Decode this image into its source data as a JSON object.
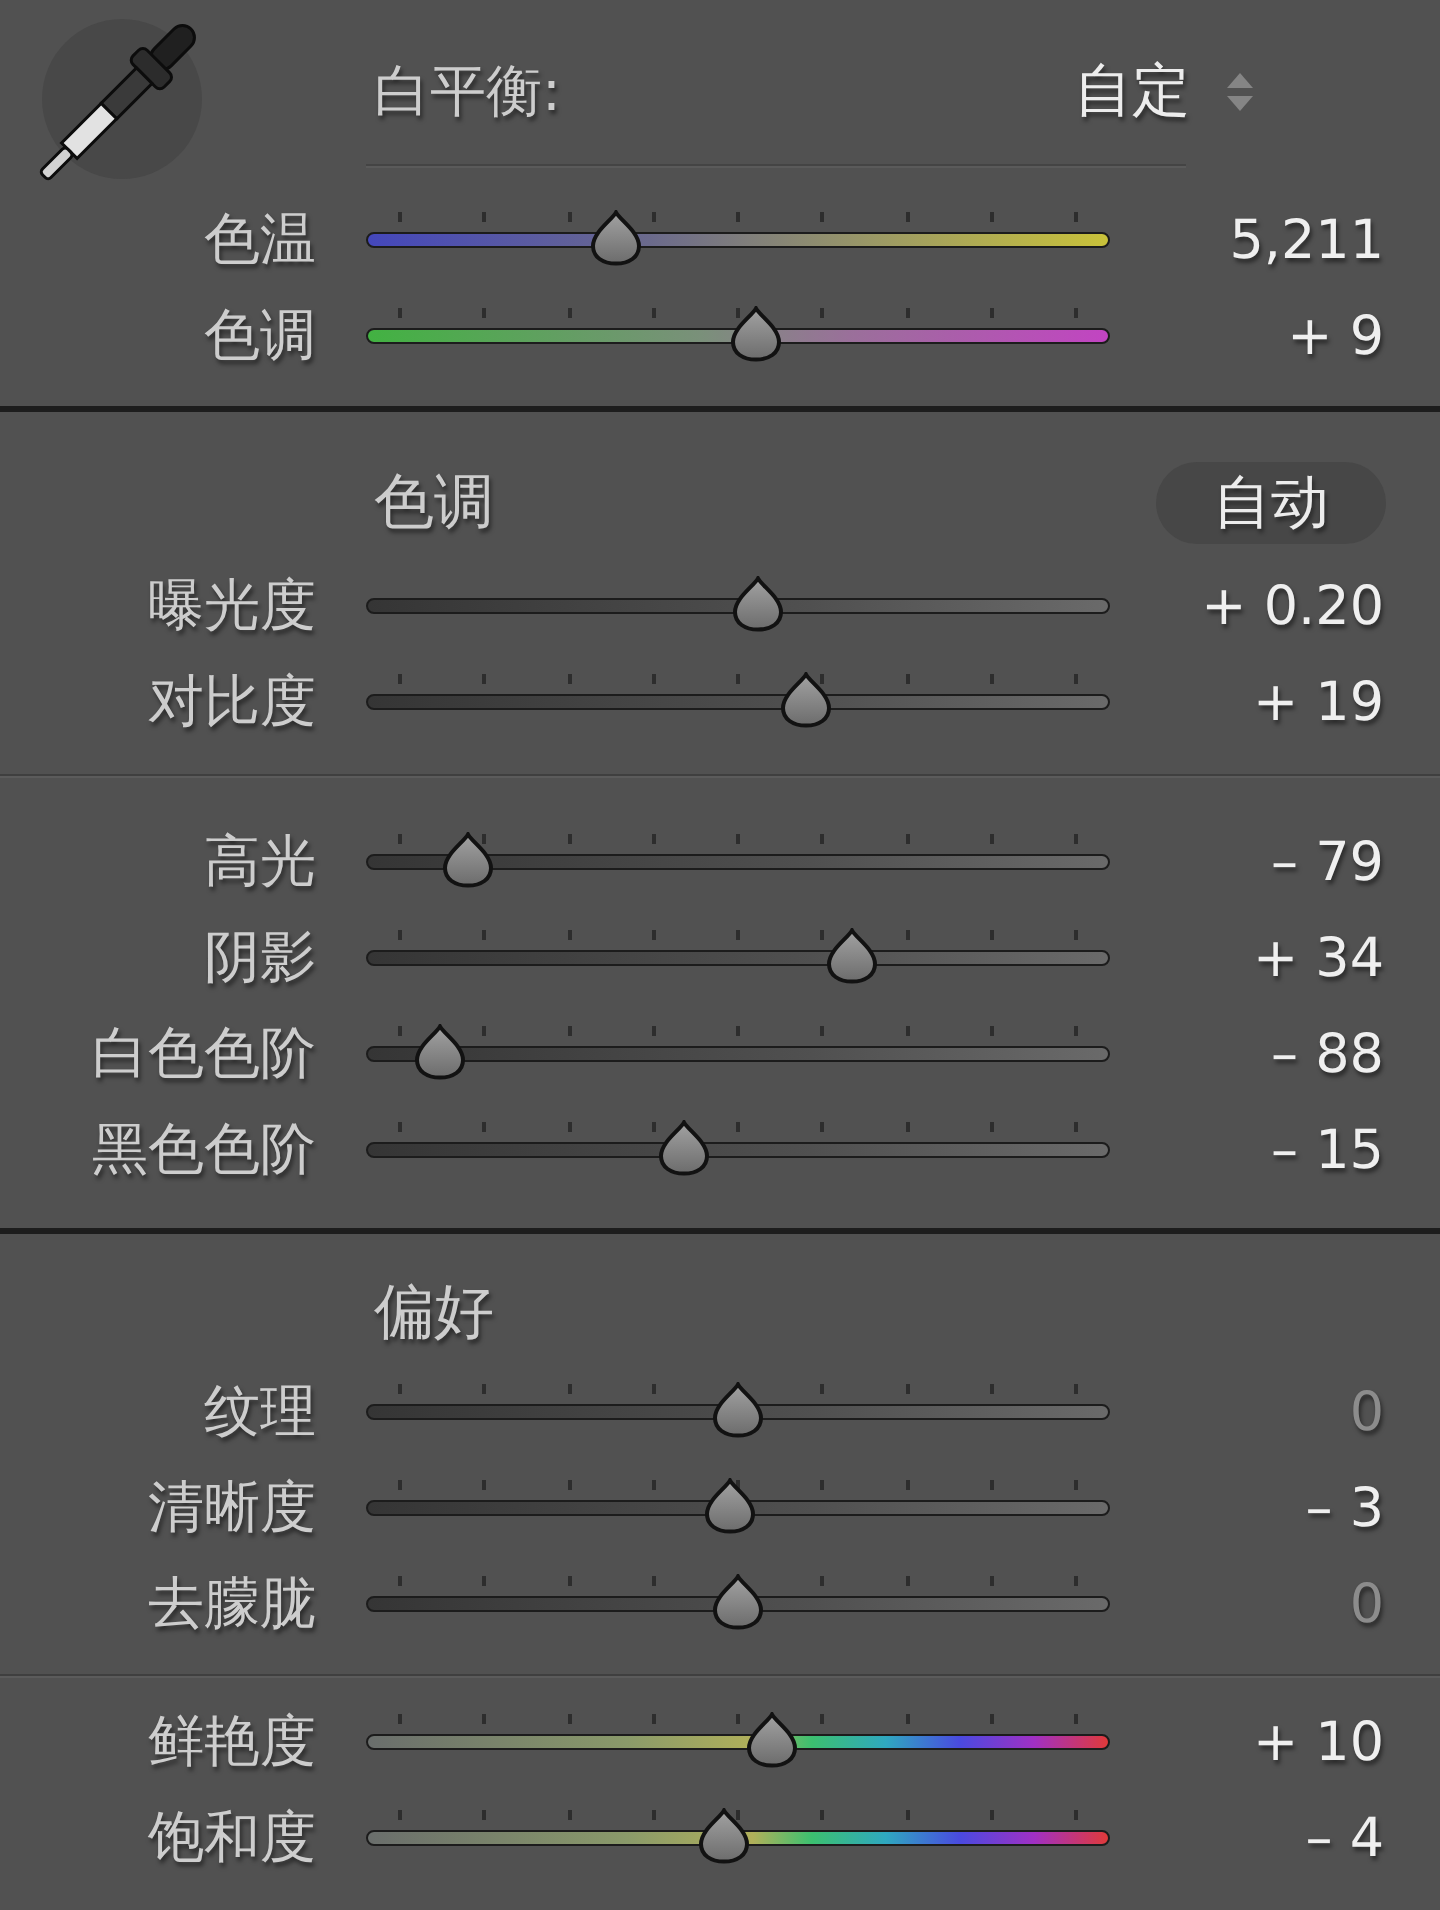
{
  "sections": [
    {
      "kind": "white_balance",
      "label": "白平衡:",
      "preset": "自定",
      "groups": [
        {
          "sliders": [
            {
              "label": "色温",
              "value": "5,211",
              "level": 0.32,
              "kind": "temperature",
              "ticks": true,
              "dimmed": false
            },
            {
              "label": "色调",
              "value": "+ 9",
              "level": 0.526,
              "kind": "tint",
              "ticks": true,
              "dimmed": false
            }
          ]
        }
      ]
    },
    {
      "kind": "tone",
      "title": "色调",
      "button": "自动",
      "groups": [
        {
          "sliders": [
            {
              "label": "曝光度",
              "value": "+ 0.20",
              "level": 0.53,
              "kind": "grey",
              "ticks": false,
              "dimmed": false
            },
            {
              "label": "对比度",
              "value": "+ 19",
              "level": 0.6,
              "kind": "grey",
              "ticks": true,
              "dimmed": false
            }
          ]
        },
        {
          "sliders": [
            {
              "label": "高光",
              "value": "– 79",
              "level": 0.104,
              "kind": "grey",
              "ticks": true,
              "dimmed": false
            },
            {
              "label": "阴影",
              "value": "+ 34",
              "level": 0.668,
              "kind": "grey",
              "ticks": true,
              "dimmed": false
            },
            {
              "label": "白色色阶",
              "value": "– 88",
              "level": 0.062,
              "kind": "grey",
              "ticks": true,
              "dimmed": false
            },
            {
              "label": "黑色色阶",
              "value": "– 15",
              "level": 0.42,
              "kind": "grey",
              "ticks": true,
              "dimmed": false
            }
          ]
        }
      ]
    },
    {
      "kind": "presence",
      "title": "偏好",
      "groups": [
        {
          "sliders": [
            {
              "label": "纹理",
              "value": "0",
              "level": 0.5,
              "kind": "grey",
              "ticks": true,
              "dimmed": true
            },
            {
              "label": "清晰度",
              "value": "– 3",
              "level": 0.487,
              "kind": "grey",
              "ticks": true,
              "dimmed": false
            },
            {
              "label": "去朦胧",
              "value": "0",
              "level": 0.5,
              "kind": "grey",
              "ticks": true,
              "dimmed": true
            }
          ]
        },
        {
          "sliders": [
            {
              "label": "鲜艳度",
              "value": "+ 10",
              "level": 0.55,
              "kind": "spectrum",
              "ticks": true,
              "dimmed": false
            },
            {
              "label": "饱和度",
              "value": "– 4",
              "level": 0.48,
              "kind": "spectrum",
              "ticks": true,
              "dimmed": false
            }
          ]
        }
      ]
    }
  ]
}
